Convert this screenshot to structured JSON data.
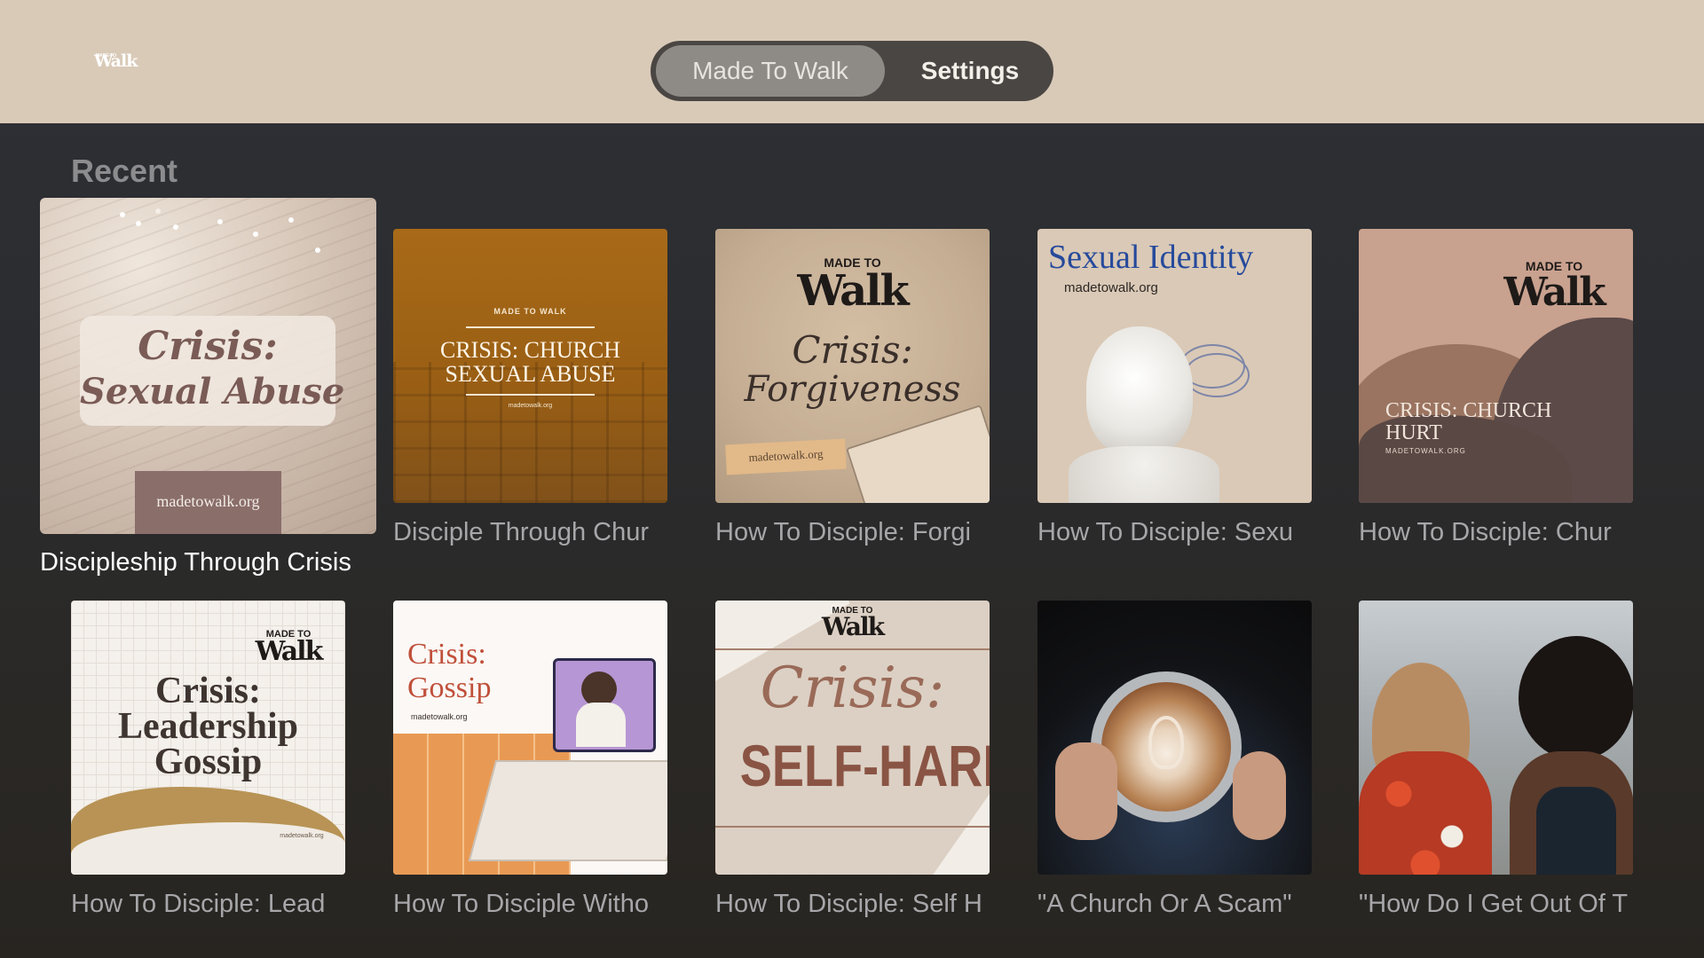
{
  "header": {
    "logo_small": "MADE TO",
    "logo_text": "Walk",
    "tabs": [
      {
        "label": "Made To Walk",
        "selected": true
      },
      {
        "label": "Settings",
        "selected": false
      }
    ]
  },
  "section": {
    "title": "Recent"
  },
  "items": [
    {
      "title": "Discipleship Through Crisis",
      "art": {
        "line1": "Crisis:",
        "line2": "Sexual Abuse",
        "footer": "madetowalk.org"
      }
    },
    {
      "title": "Disciple Through Chur",
      "art": {
        "top": "MADE TO WALK",
        "line1": "CRISIS: CHURCH",
        "line2": "SEXUAL ABUSE",
        "footer": "madetowalk.org"
      }
    },
    {
      "title": "How To Disciple: Forgi",
      "art": {
        "brand_small": "MADE TO",
        "brand": "Walk",
        "line1": "Crisis:",
        "line2": "Forgiveness",
        "footer": "madetowalk.org"
      }
    },
    {
      "title": "How To Disciple: Sexu",
      "art": {
        "line1": "Sexual Identity",
        "footer": "madetowalk.org"
      }
    },
    {
      "title": "How To Disciple: Chur",
      "art": {
        "brand_small": "MADE TO",
        "brand": "Walk",
        "line1": "CRISIS: CHURCH",
        "line2": "HURT",
        "footer": "MADETOWALK.ORG"
      }
    },
    {
      "title": "How To Disciple: Lead",
      "art": {
        "brand_small": "MADE TO",
        "brand": "Walk",
        "line1": "Crisis:",
        "line2": "Leadership",
        "line3": "Gossip",
        "footer": "madetowalk.org"
      }
    },
    {
      "title": "How To Disciple Witho",
      "art": {
        "line1": "Crisis:",
        "line2": "Gossip",
        "footer": "madetowalk.org"
      }
    },
    {
      "title": "How To Disciple: Self H",
      "art": {
        "brand_small": "MADE TO",
        "brand": "Walk",
        "line1": "Crisis:",
        "line2": "SELF-HARM"
      }
    },
    {
      "title": "\"A Church Or A Scam\"",
      "art": {}
    },
    {
      "title": "\"How Do I Get Out Of T",
      "art": {}
    }
  ]
}
